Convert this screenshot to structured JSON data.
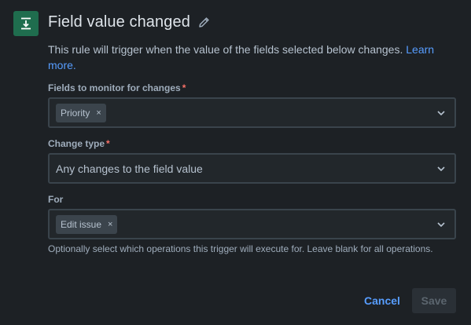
{
  "header": {
    "title": "Field value changed",
    "icon": "download-arrow-icon",
    "icon_color": "#1f6d4e"
  },
  "description": {
    "text": "This rule will trigger when the value of the fields selected below changes. ",
    "link_text": "Learn more."
  },
  "fields_to_monitor": {
    "label": "Fields to monitor for changes",
    "required_mark": "*",
    "selected": [
      {
        "label": "Priority",
        "remove": "×"
      }
    ]
  },
  "change_type": {
    "label": "Change type",
    "required_mark": "*",
    "value": "Any changes to the field value"
  },
  "for_operations": {
    "label": "For",
    "selected": [
      {
        "label": "Edit issue",
        "remove": "×"
      }
    ],
    "helper": "Optionally select which operations this trigger will execute for. Leave blank for all operations."
  },
  "actions": {
    "cancel_label": "Cancel",
    "save_label": "Save"
  },
  "colors": {
    "background": "#1d2125",
    "link": "#579dff",
    "required": "#f87168"
  }
}
